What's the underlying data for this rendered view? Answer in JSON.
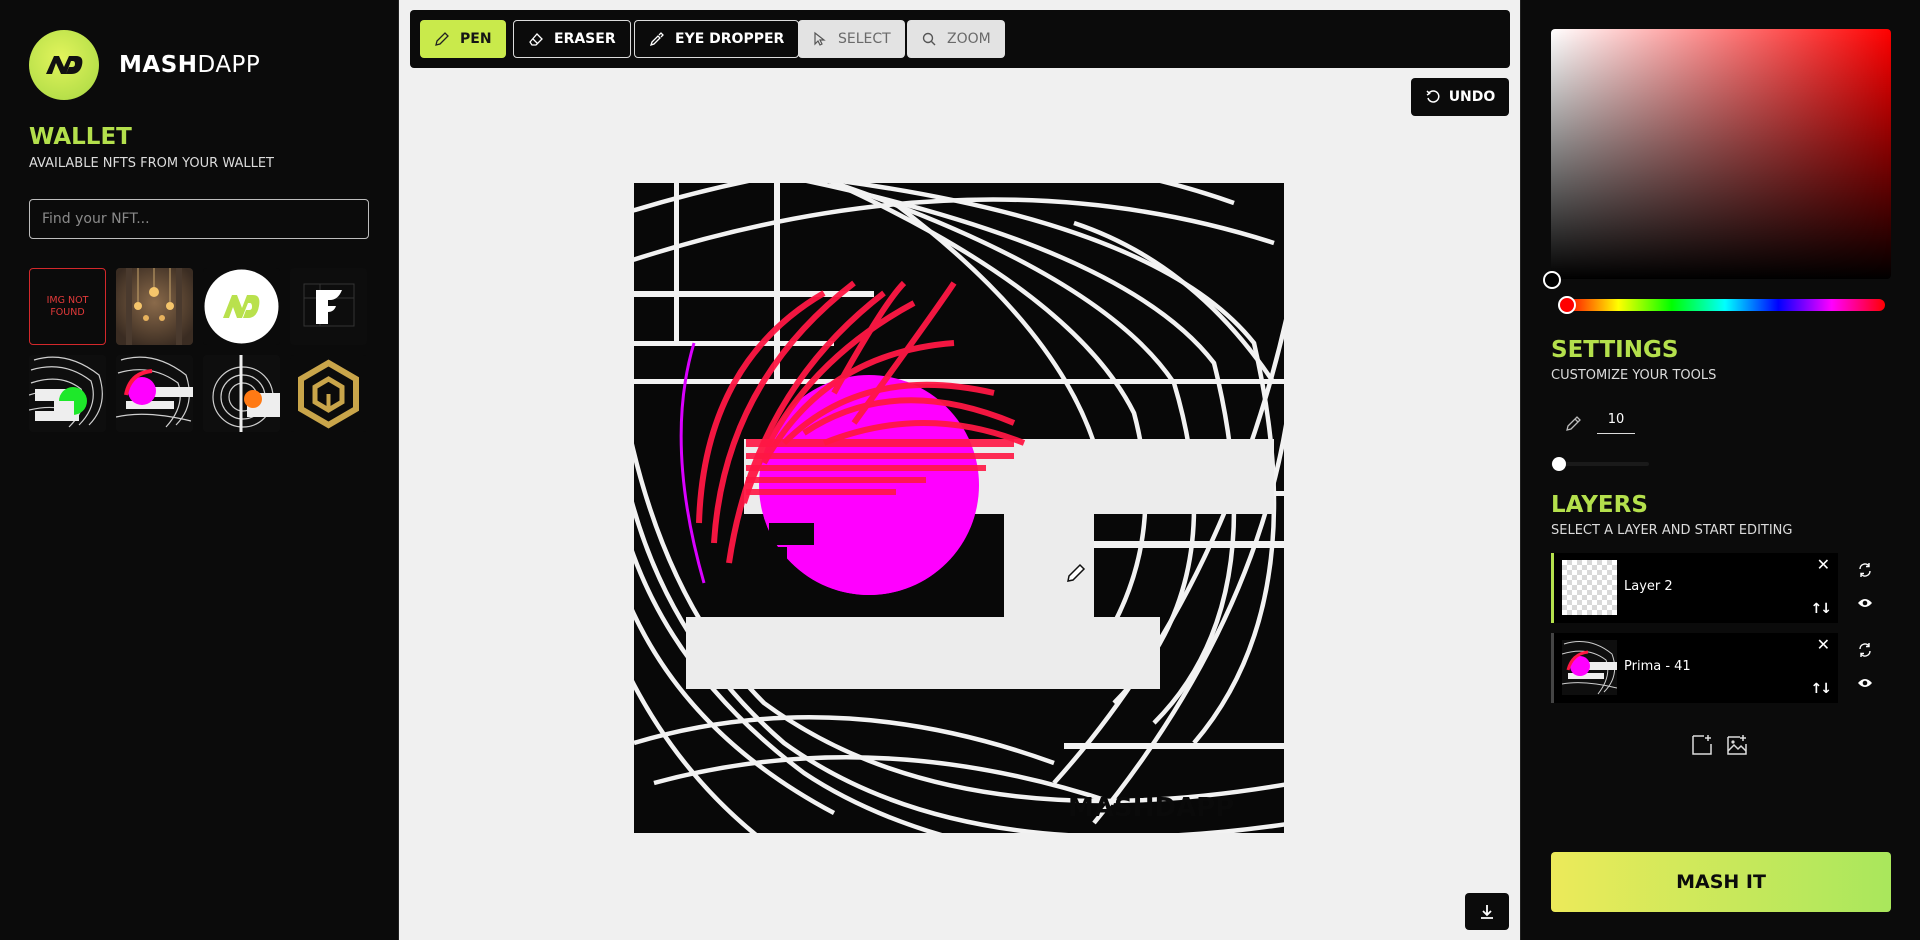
{
  "brand": {
    "name_bold": "MASH",
    "name_light": "DAPP",
    "logo_text": "MD"
  },
  "wallet": {
    "title": "WALLET",
    "subtitle": "AVAILABLE NFTS FROM YOUR WALLET",
    "search_placeholder": "Find your NFT...",
    "nfts": [
      {
        "type": "not-found",
        "label": "IMG NOT FOUND"
      },
      {
        "type": "image",
        "icon": "chandelier-room-image"
      },
      {
        "type": "image",
        "icon": "mashdapp-logo-image"
      },
      {
        "type": "image",
        "icon": "letter-f-logo-image"
      },
      {
        "type": "image",
        "icon": "green-circle-art-image"
      },
      {
        "type": "image",
        "icon": "magenta-circle-art-image"
      },
      {
        "type": "image",
        "icon": "orange-circle-art-image"
      },
      {
        "type": "image",
        "icon": "gold-cube-logo-image"
      }
    ]
  },
  "toolbar": {
    "pen": "PEN",
    "eraser": "ERASER",
    "eye_dropper": "EYE DROPPER",
    "select": "SELECT",
    "zoom": "ZOOM",
    "undo": "UNDO"
  },
  "canvas": {
    "watermark": "MASHDAPP",
    "cursor_icon": "pencil-icon"
  },
  "colors": {
    "accent": "#b4e04c",
    "active_tool": "#c9ea4b",
    "magenta": "#ff00ff",
    "red_stroke": "#ff1744",
    "selected_color": "#000000"
  },
  "settings": {
    "title": "SETTINGS",
    "subtitle": "CUSTOMIZE YOUR TOOLS",
    "brush_size": "10"
  },
  "layers": {
    "title": "LAYERS",
    "subtitle": "SELECT A LAYER AND START EDITING",
    "items": [
      {
        "name": "Layer 2",
        "selected": true
      },
      {
        "name": "Prima - 41",
        "selected": false
      }
    ]
  },
  "actions": {
    "mash_it": "MASH IT"
  }
}
